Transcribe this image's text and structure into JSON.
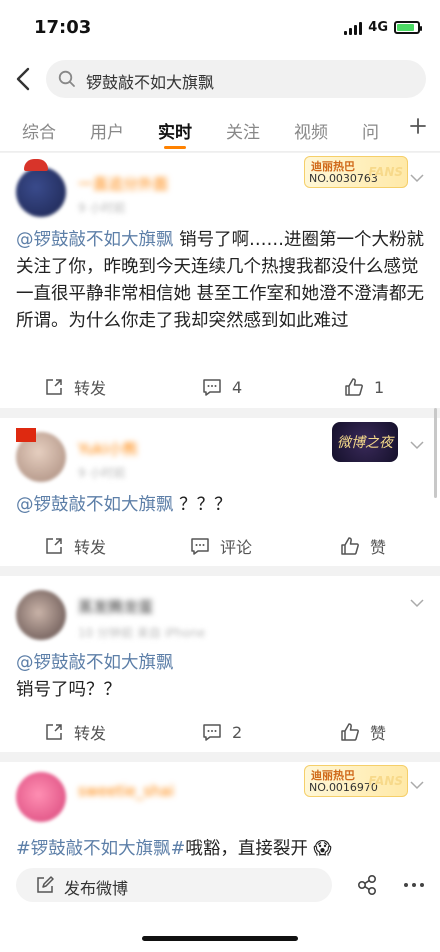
{
  "status": {
    "time": "17:03",
    "network": "4G",
    "battery_level": 0.85
  },
  "search": {
    "query": "锣鼓敲不如大旗飘"
  },
  "tabs": [
    {
      "label": "综合",
      "active": false
    },
    {
      "label": "用户",
      "active": false
    },
    {
      "label": "实时",
      "active": true
    },
    {
      "label": "关注",
      "active": false
    },
    {
      "label": "视频",
      "active": false
    },
    {
      "label": "问",
      "active": false
    }
  ],
  "colors": {
    "accent": "#ff8200",
    "link": "#5d7fa8"
  },
  "posts": [
    {
      "username": "一直追分外面",
      "meta": "9 小时前",
      "badge": {
        "title": "迪丽热巴",
        "number": "NO.0030763",
        "fans": "FANS"
      },
      "mention": "@锣鼓敲不如大旗飘",
      "text": " 销号了啊……进圈第一个大粉就关注了你，昨晚到今天连续几个热搜我都没什么感觉一直很平静非常相信她  甚至工作室和她澄不澄清都无所谓。为什么你走了我却突然感到如此难过",
      "repost": "转发",
      "comments": "4",
      "likes": "1"
    },
    {
      "username": "Yuki小熊",
      "meta": "9 小时前",
      "badge_text": "微博之夜",
      "mention": "@锣鼓敲不如大旗飘",
      "text": " ？？？",
      "repost": "转发",
      "comments": "评论",
      "likes": "赞"
    },
    {
      "username": "蒸发腾龙蛋",
      "meta": "10 分钟前  来自 iPhone",
      "mention": "@锣鼓敲不如大旗飘",
      "text": "销号了吗？？",
      "repost": "转发",
      "comments": "2",
      "likes": "赞"
    },
    {
      "username": "sweetie_shai",
      "meta": "",
      "badge": {
        "title": "迪丽热巴",
        "number": "NO.0016970",
        "fans": "FANS"
      },
      "mention": "#锣鼓敲不如大旗飘#",
      "text": "哦豁，直接裂开",
      "emoji": "😱"
    }
  ],
  "bottom": {
    "compose_label": "发布微博"
  }
}
